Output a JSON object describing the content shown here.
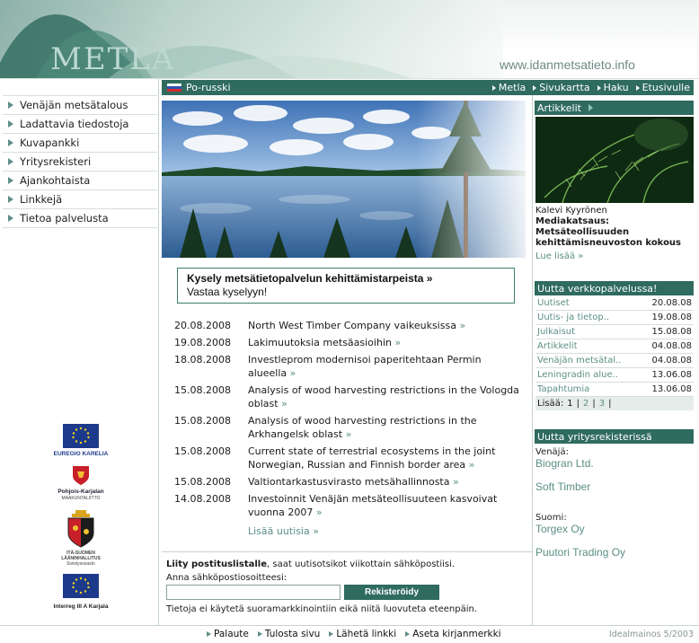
{
  "header": {
    "logo_text": "METLA",
    "site_url": "www.idanmetsatieto.info"
  },
  "left_nav": {
    "items": [
      {
        "label": "Venäjän metsätalous"
      },
      {
        "label": "Ladattavia tiedostoja"
      },
      {
        "label": "Kuvapankki"
      },
      {
        "label": "Yritysrekisteri"
      },
      {
        "label": "Ajankohtaista"
      },
      {
        "label": "Linkkejä"
      },
      {
        "label": "Tietoa palvelusta"
      }
    ]
  },
  "logos": {
    "euregio": "EUREGIO KARELIA",
    "pohjois_karjala": "Pohjois-Karjalan",
    "pohjois_karjala_sub": "MAAKUNTALIITTO",
    "ita_suomi_1": "ITÄ-SUOMEN",
    "ita_suomi_2": "LÄÄNINHALLITUS",
    "ita_suomi_3": "Sivistysosasto",
    "interreg": "Interreg III A Karjala"
  },
  "topbar": {
    "language_link": "Po-russki",
    "links": [
      {
        "label": "Metla"
      },
      {
        "label": "Sivukartta"
      },
      {
        "label": "Haku"
      },
      {
        "label": "Etusivulle"
      }
    ]
  },
  "survey": {
    "title": "Kysely metsätietopalvelun kehittämistarpeista »",
    "link": "Vastaa kyselyyn!"
  },
  "news": {
    "items": [
      {
        "date": "20.08.2008",
        "title": "North West Timber Company vaikeuksissa"
      },
      {
        "date": "19.08.2008",
        "title": "Lakimuutoksia metsäasioihin"
      },
      {
        "date": "18.08.2008",
        "title": "Investleprom modernisoi paperitehtaan Permin alueella"
      },
      {
        "date": "15.08.2008",
        "title": "Analysis of wood harvesting restrictions in the Vologda oblast"
      },
      {
        "date": "15.08.2008",
        "title": "Analysis of wood harvesting restrictions in the Arkhangelsk oblast"
      },
      {
        "date": "15.08.2008",
        "title": "Current state of terrestrial ecosystems in the joint Norwegian, Russian and Finnish border area"
      },
      {
        "date": "15.08.2008",
        "title": "Valtiontarkastusvirasto metsähallinnosta"
      },
      {
        "date": "14.08.2008",
        "title": "Investoinnit Venäjän metsäteollisuuteen kasvoivat vuonna 2007"
      }
    ],
    "more": "Lisää uutisia »",
    "raquo": "»"
  },
  "newsletter": {
    "bold": "Liity postituslistalle",
    "rest": ", saat uutisotsikot viikottain sähköpostiisi.",
    "label": "Anna sähköpostiosoitteesi:",
    "email_value": "",
    "register": "Rekisteröidy",
    "note": "Tietoja ei käytetä suoramarkkinointiin eikä niitä luovuteta eteenpäin."
  },
  "articles": {
    "heading": "Artikkelit",
    "author": "Kalevi Kyyrönen",
    "title_line1": "Mediakatsaus:",
    "title_line2": "Metsäteollisuuden kehittämisneuvoston kokous",
    "more": "Lue lisää »"
  },
  "services": {
    "heading": "Uutta verkkopalvelussa!",
    "rows": [
      {
        "name": "Uutiset",
        "date": "20.08.08"
      },
      {
        "name": "Uutis- ja tietop..",
        "date": "19.08.08"
      },
      {
        "name": "Julkaisut",
        "date": "15.08.08"
      },
      {
        "name": "Artikkelit",
        "date": "04.08.08"
      },
      {
        "name": "Venäjän metsätal..",
        "date": "04.08.08"
      },
      {
        "name": "Leningradin alue..",
        "date": "13.06.08"
      },
      {
        "name": "Tapahtumia",
        "date": "13.06.08"
      }
    ],
    "pager_label": "Lisää:",
    "pages": [
      "1",
      "2",
      "3"
    ]
  },
  "registry": {
    "heading": "Uutta yritysrekisterissä",
    "groups": [
      {
        "country": "Venäjä:",
        "companies": [
          "Biogran Ltd.",
          "Soft Timber"
        ]
      },
      {
        "country": "Suomi:",
        "companies": [
          "Torgex Oy",
          "Puutori Trading Oy"
        ]
      }
    ]
  },
  "footer": {
    "links": [
      {
        "label": "Palaute"
      },
      {
        "label": "Tulosta sivu"
      },
      {
        "label": "Lähetä linkki"
      },
      {
        "label": "Aseta kirjanmerkki"
      }
    ],
    "credit": "Idealmainos 5/2003"
  },
  "colors": {
    "accent": "#2f6b5f",
    "link": "#5b8f86"
  }
}
